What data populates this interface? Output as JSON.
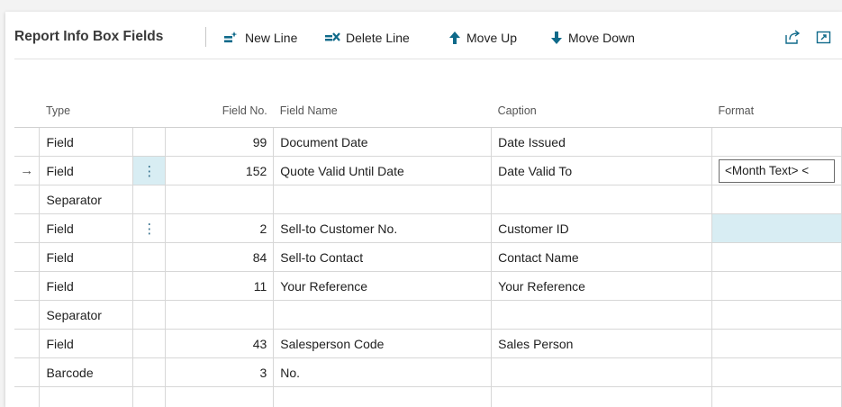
{
  "page": {
    "title": "Report Info Box Fields"
  },
  "toolbar": {
    "new_line": "New Line",
    "delete_line": "Delete Line",
    "move_up": "Move Up",
    "move_down": "Move Down",
    "share_icon": "share-icon",
    "expand_icon": "expand-icon"
  },
  "colors": {
    "accent": "#0f6a8a",
    "selected_cell": "#d8edf3"
  },
  "table": {
    "columns": {
      "type": "Type",
      "field_no": "Field No.",
      "field_name": "Field Name",
      "caption": "Caption",
      "format": "Format"
    },
    "rows": [
      {
        "type": "Field",
        "field_no": "99",
        "field_name": "Document Date",
        "caption": "Date Issued",
        "format": ""
      },
      {
        "type": "Field",
        "field_no": "152",
        "field_name": "Quote Valid Until Date",
        "caption": "Date Valid To",
        "format": "<Month Text> <"
      },
      {
        "type": "Separator",
        "field_no": "",
        "field_name": "",
        "caption": "",
        "format": ""
      },
      {
        "type": "Field",
        "field_no": "2",
        "field_name": "Sell-to Customer No.",
        "caption": "Customer ID",
        "format": ""
      },
      {
        "type": "Field",
        "field_no": "84",
        "field_name": "Sell-to Contact",
        "caption": "Contact Name",
        "format": ""
      },
      {
        "type": "Field",
        "field_no": "11",
        "field_name": "Your Reference",
        "caption": "Your Reference",
        "format": ""
      },
      {
        "type": "Separator",
        "field_no": "",
        "field_name": "",
        "caption": "",
        "format": ""
      },
      {
        "type": "Field",
        "field_no": "43",
        "field_name": "Salesperson Code",
        "caption": "Sales Person",
        "format": ""
      },
      {
        "type": "Barcode",
        "field_no": "3",
        "field_name": "No.",
        "caption": "",
        "format": ""
      },
      {
        "type": "",
        "field_no": "",
        "field_name": "",
        "caption": "",
        "format": ""
      }
    ]
  }
}
